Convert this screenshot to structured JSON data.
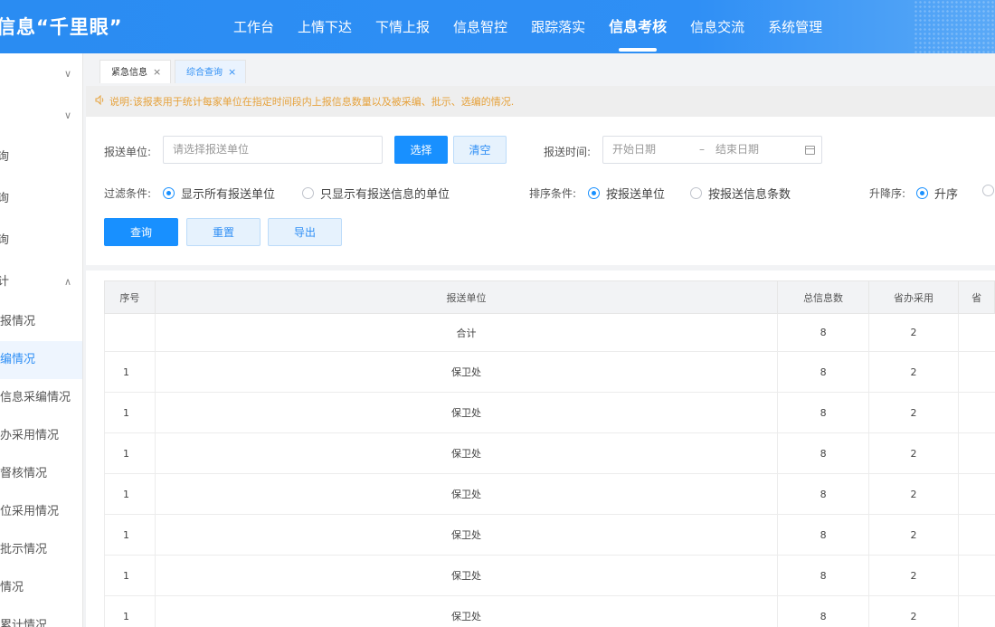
{
  "header": {
    "brand": "信息“千里眼”",
    "nav": [
      {
        "label": "工作台",
        "active": false
      },
      {
        "label": "上情下达",
        "active": false
      },
      {
        "label": "下情上报",
        "active": false
      },
      {
        "label": "信息智控",
        "active": false
      },
      {
        "label": "跟踪落实",
        "active": false
      },
      {
        "label": "信息考核",
        "active": true
      },
      {
        "label": "信息交流",
        "active": false
      },
      {
        "label": "系统管理",
        "active": false
      }
    ]
  },
  "sidebar": {
    "items": [
      {
        "label": "",
        "chevron": "chevron-down-icon"
      },
      {
        "label": "",
        "chevron": "chevron-down-icon"
      },
      {
        "label": "询"
      },
      {
        "label": "询"
      },
      {
        "label": "询"
      },
      {
        "label": "计",
        "chevron": "chevron-up-icon"
      },
      {
        "label": "报情况"
      },
      {
        "label": "编情况",
        "active": true
      },
      {
        "label": "信息采编情况"
      },
      {
        "label": "办采用情况"
      },
      {
        "label": "督核情况"
      },
      {
        "label": "位采用情况"
      },
      {
        "label": "批示情况"
      },
      {
        "label": "情况"
      },
      {
        "label": "累计情况"
      }
    ]
  },
  "tabs": [
    {
      "label": "紧急信息",
      "close": "×",
      "active": false
    },
    {
      "label": "综合查询",
      "close": "×",
      "active": true
    }
  ],
  "notice": {
    "icon": "speaker-icon",
    "text": "说明:该报表用于统计每家单位在指定时间段内上报信息数量以及被采编、批示、选编的情况."
  },
  "filters": {
    "unit_label": "报送单位:",
    "unit_placeholder": "请选择报送单位",
    "select_btn": "选择",
    "clear_btn": "清空",
    "time_label": "报送时间:",
    "start_placeholder": "开始日期",
    "date_sep": "–",
    "end_placeholder": "结束日期",
    "filter_label": "过滤条件:",
    "filter_opt1": "显示所有报送单位",
    "filter_opt2": "只显示有报送信息的单位",
    "sort_label": "排序条件:",
    "sort_opt1": "按报送单位",
    "sort_opt2": "按报送信息条数",
    "order_label": "升降序:",
    "order_opt1": "升序",
    "query_btn": "查询",
    "reset_btn": "重置",
    "export_btn": "导出"
  },
  "table": {
    "headers": [
      "序号",
      "报送单位",
      "总信息数",
      "省办采用",
      "省"
    ],
    "summary": {
      "index": "",
      "unit": "合计",
      "total": "8",
      "adopted": "2"
    },
    "rows": [
      {
        "index": "1",
        "unit": "保卫处",
        "total": "8",
        "adopted": "2"
      },
      {
        "index": "1",
        "unit": "保卫处",
        "total": "8",
        "adopted": "2"
      },
      {
        "index": "1",
        "unit": "保卫处",
        "total": "8",
        "adopted": "2"
      },
      {
        "index": "1",
        "unit": "保卫处",
        "total": "8",
        "adopted": "2"
      },
      {
        "index": "1",
        "unit": "保卫处",
        "total": "8",
        "adopted": "2"
      },
      {
        "index": "1",
        "unit": "保卫处",
        "total": "8",
        "adopted": "2"
      },
      {
        "index": "1",
        "unit": "保卫处",
        "total": "8",
        "adopted": "2"
      }
    ]
  }
}
